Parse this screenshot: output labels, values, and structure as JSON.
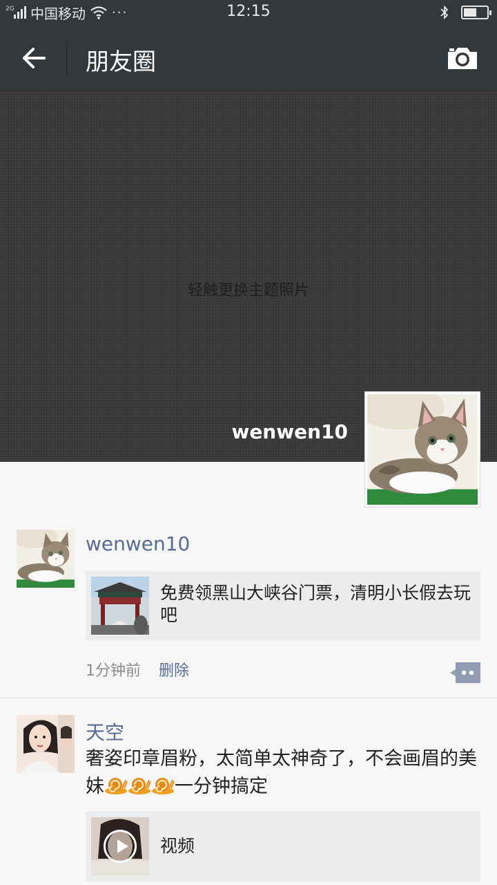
{
  "status_bar": {
    "network_type": "2G",
    "carrier": "中国移动",
    "more_dots": "···",
    "time": "12:15",
    "battery_level": 0.55
  },
  "header": {
    "title": "朋友圈",
    "back_icon": "arrow-left-icon",
    "camera_icon": "camera-icon"
  },
  "cover": {
    "hint": "轻触更换主题照片",
    "user_name": "wenwen10"
  },
  "posts": [
    {
      "author": "wenwen10",
      "link": {
        "title": "免费领黑山大峡谷门票，清明小长假去玩吧"
      },
      "time": "1分钟前",
      "delete_label": "删除"
    },
    {
      "author": "天空",
      "text_before_emoji": "奢姿印章眉粉，太简单太神奇了，不会画眉的美妹",
      "text_after_emoji": "一分钟搞定",
      "emoji": "snail-icon",
      "link": {
        "title": "视频"
      }
    }
  ],
  "colors": {
    "bar_bg": "#33383c",
    "name_link": "#576b95",
    "page_bg": "#f7f7f7",
    "card_bg": "#ececec"
  }
}
